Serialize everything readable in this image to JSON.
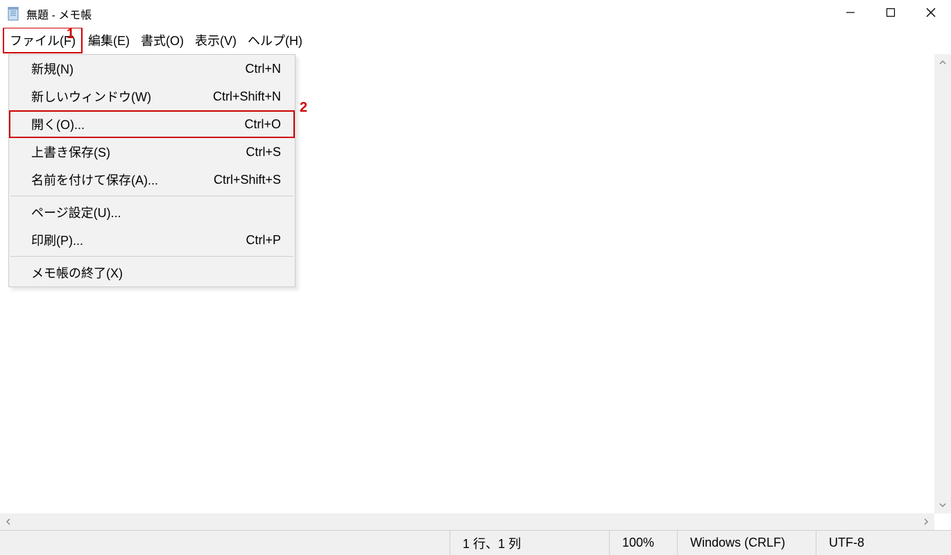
{
  "window": {
    "title": "無題 - メモ帳"
  },
  "menubar": {
    "items": [
      {
        "label": "ファイル(F)",
        "active": true
      },
      {
        "label": "編集(E)",
        "active": false
      },
      {
        "label": "書式(O)",
        "active": false
      },
      {
        "label": "表示(V)",
        "active": false
      },
      {
        "label": "ヘルプ(H)",
        "active": false
      }
    ]
  },
  "dropdown": {
    "items": [
      {
        "label": "新規(N)",
        "shortcut": "Ctrl+N",
        "highlighted": false,
        "separatorAfter": false
      },
      {
        "label": "新しいウィンドウ(W)",
        "shortcut": "Ctrl+Shift+N",
        "highlighted": false,
        "separatorAfter": false
      },
      {
        "label": "開く(O)...",
        "shortcut": "Ctrl+O",
        "highlighted": true,
        "separatorAfter": false
      },
      {
        "label": "上書き保存(S)",
        "shortcut": "Ctrl+S",
        "highlighted": false,
        "separatorAfter": false
      },
      {
        "label": "名前を付けて保存(A)...",
        "shortcut": "Ctrl+Shift+S",
        "highlighted": false,
        "separatorAfter": true
      },
      {
        "label": "ページ設定(U)...",
        "shortcut": "",
        "highlighted": false,
        "separatorAfter": false
      },
      {
        "label": "印刷(P)...",
        "shortcut": "Ctrl+P",
        "highlighted": false,
        "separatorAfter": true
      },
      {
        "label": "メモ帳の終了(X)",
        "shortcut": "",
        "highlighted": false,
        "separatorAfter": false
      }
    ]
  },
  "statusbar": {
    "position": "1 行、1 列",
    "zoom": "100%",
    "lineEnding": "Windows (CRLF)",
    "encoding": "UTF-8"
  },
  "annotations": {
    "one": "1",
    "two": "2"
  }
}
